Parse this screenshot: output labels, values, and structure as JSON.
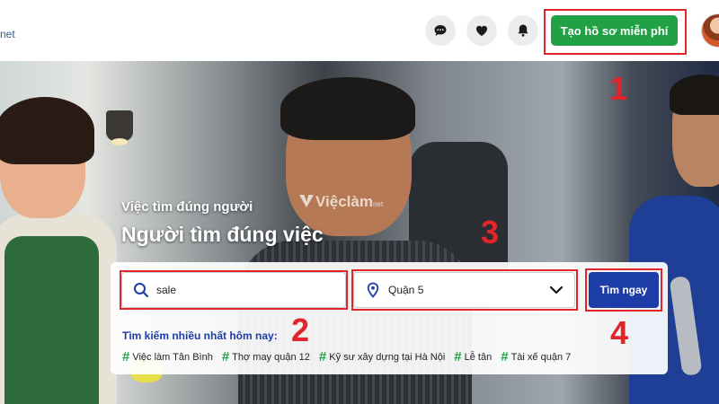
{
  "header": {
    "logo_fragment": "net",
    "cta_label": "Tạo hồ sơ miễn phí",
    "icons": [
      "chat-icon",
      "heart-icon",
      "bell-icon"
    ]
  },
  "hero": {
    "tagline": "Việc tìm đúng người",
    "heading": "Người tìm đúng việc",
    "watermark": "Việclàm",
    "watermark_suffix": "net"
  },
  "search": {
    "keyword_value": "sale",
    "location_value": "Quận 5",
    "button_label": "Tìm ngay",
    "trending_label": "Tìm kiếm nhiều nhất hôm nay:",
    "trending_tags": [
      "Việc làm Tân Bình",
      "Thợ may quận 12",
      "Kỹ sư xây dựng tại Hà Nội",
      "Lễ tân",
      "Tài xế quận 7"
    ]
  },
  "annotations": [
    "1",
    "2",
    "3",
    "4"
  ],
  "colors": {
    "primary_green": "#22a046",
    "primary_blue": "#1d3da8",
    "annotation_red": "#e0262b"
  }
}
